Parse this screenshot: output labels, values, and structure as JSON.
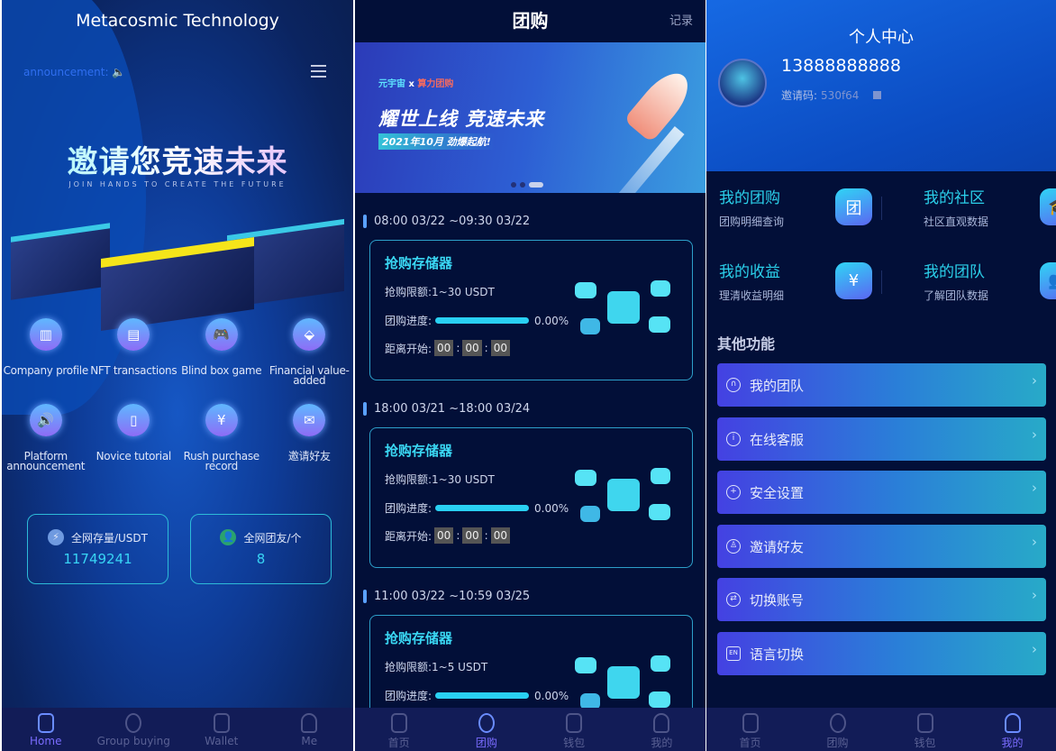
{
  "home": {
    "title": "Metacosmic Technology",
    "announcement": "announcement:",
    "slogan": "邀请您竞速未来",
    "slogan_sub": "JOIN HANDS TO CREATE THE FUTURE",
    "grid": [
      {
        "label": "Company profile",
        "icon": "building-icon"
      },
      {
        "label": "NFT transactions",
        "icon": "shop-icon"
      },
      {
        "label": "Blind box game",
        "icon": "gamepad-icon"
      },
      {
        "label": "Financial value-added",
        "icon": "finance-icon"
      },
      {
        "label": "Platform announcement",
        "icon": "speaker-icon"
      },
      {
        "label": "Novice tutorial",
        "icon": "book-icon"
      },
      {
        "label": "Rush purchase record",
        "icon": "yuan-icon"
      },
      {
        "label": "邀请好友",
        "icon": "invite-mail-icon"
      }
    ],
    "stats": [
      {
        "label": "全网存量/USDT",
        "value": "11749241"
      },
      {
        "label": "全网团友/个",
        "value": "8"
      }
    ],
    "nav": [
      "Home",
      "Group buying",
      "Wallet",
      "Me"
    ]
  },
  "group": {
    "title": "团购",
    "record": "记录",
    "banner": {
      "line1a": "元宇宙",
      "line1x": "x",
      "line1b": "算力团购",
      "headline": "耀世上线 竞速未来",
      "date": "2021年10月 劲爆起航!",
      "active_slide": 3,
      "slides": 3
    },
    "slots": [
      {
        "time": "08:00 03/22 ~09:30 03/22",
        "title": "抢购存储器",
        "limit": "抢购限额:1~30 USDT",
        "progress_label": "团购进度:",
        "progress": "0.00%",
        "countdown_label": "距离开始:",
        "h": "00",
        "m": "00",
        "s": "00"
      },
      {
        "time": "18:00 03/21 ~18:00 03/24",
        "title": "抢购存储器",
        "limit": "抢购限额:1~30 USDT",
        "progress_label": "团购进度:",
        "progress": "0.00%",
        "countdown_label": "距离开始:",
        "h": "00",
        "m": "00",
        "s": "00"
      },
      {
        "time": "11:00 03/22 ~10:59 03/25",
        "title": "抢购存储器",
        "limit": "抢购限额:1~5 USDT",
        "progress_label": "团购进度:",
        "progress": "0.00%"
      }
    ],
    "nav": [
      "首页",
      "团购",
      "钱包",
      "我的"
    ]
  },
  "me": {
    "title": "个人中心",
    "phone": "13888888888",
    "invite_label": "邀请码:",
    "invite_code": "530f64",
    "quads": [
      {
        "title": "我的团购",
        "sub": "团购明细查询",
        "icon": "团"
      },
      {
        "title": "我的社区",
        "sub": "社区直观数据",
        "icon": "🎓"
      },
      {
        "title": "我的收益",
        "sub": "理清收益明细",
        "icon": "¥"
      },
      {
        "title": "我的团队",
        "sub": "了解团队数据",
        "icon": "👥"
      }
    ],
    "other_title": "其他功能",
    "rows": [
      {
        "label": "我的团队",
        "icon": "headset-icon"
      },
      {
        "label": "在线客服",
        "icon": "info-icon"
      },
      {
        "label": "安全设置",
        "icon": "shield-icon"
      },
      {
        "label": "邀请好友",
        "icon": "user-add-icon"
      },
      {
        "label": "切换账号",
        "icon": "switch-icon"
      },
      {
        "label": "语言切换",
        "icon": "en-icon"
      }
    ],
    "nav": [
      "首页",
      "团购",
      "钱包",
      "我的"
    ]
  },
  "colors": {
    "accent": "#2bd0ea",
    "nav_active": "#7a6cff",
    "bg_dark": "#020f38"
  }
}
